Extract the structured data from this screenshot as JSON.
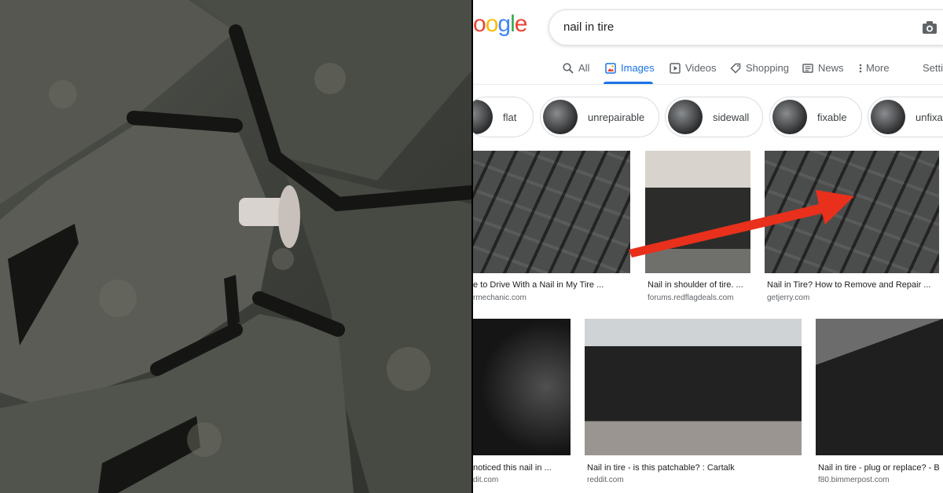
{
  "google": {
    "logo_text": "oogle",
    "logo_colors": [
      "#4285F4",
      "#EA4335",
      "#FBBC05",
      "#4285F4",
      "#34A853",
      "#EA4335"
    ],
    "search_query": "nail in tire",
    "tabs": [
      {
        "label": "All",
        "icon": "search-icon"
      },
      {
        "label": "Images",
        "icon": "image-icon"
      },
      {
        "label": "Videos",
        "icon": "play-icon"
      },
      {
        "label": "Shopping",
        "icon": "tag-icon"
      },
      {
        "label": "News",
        "icon": "news-icon"
      },
      {
        "label": "More",
        "icon": "more-vertical-icon"
      },
      {
        "label": "Setti"
      }
    ],
    "chips": [
      "flat",
      "unrepairable",
      "sidewall",
      "fixable",
      "unfixa"
    ],
    "results_row1": [
      {
        "title": "e to Drive With a Nail in My Tire ...",
        "source": "rmechanic.com"
      },
      {
        "title": "Nail in shoulder of tire. ...",
        "source": "forums.redflagdeals.com"
      },
      {
        "title": "Nail in Tire? How to Remove and Repair ...",
        "source": "getjerry.com"
      }
    ],
    "results_row2": [
      {
        "title": "noticed this nail in ...",
        "source": "dit.com"
      },
      {
        "title": "Nail in tire - is this patchable? : Cartalk",
        "source": "reddit.com"
      },
      {
        "title": "Nail in tire - plug or replace? - B",
        "source": "f80.bimmerpost.com"
      }
    ]
  },
  "colors": {
    "accent": "#1a73e8",
    "arrow": "#e8301c"
  }
}
